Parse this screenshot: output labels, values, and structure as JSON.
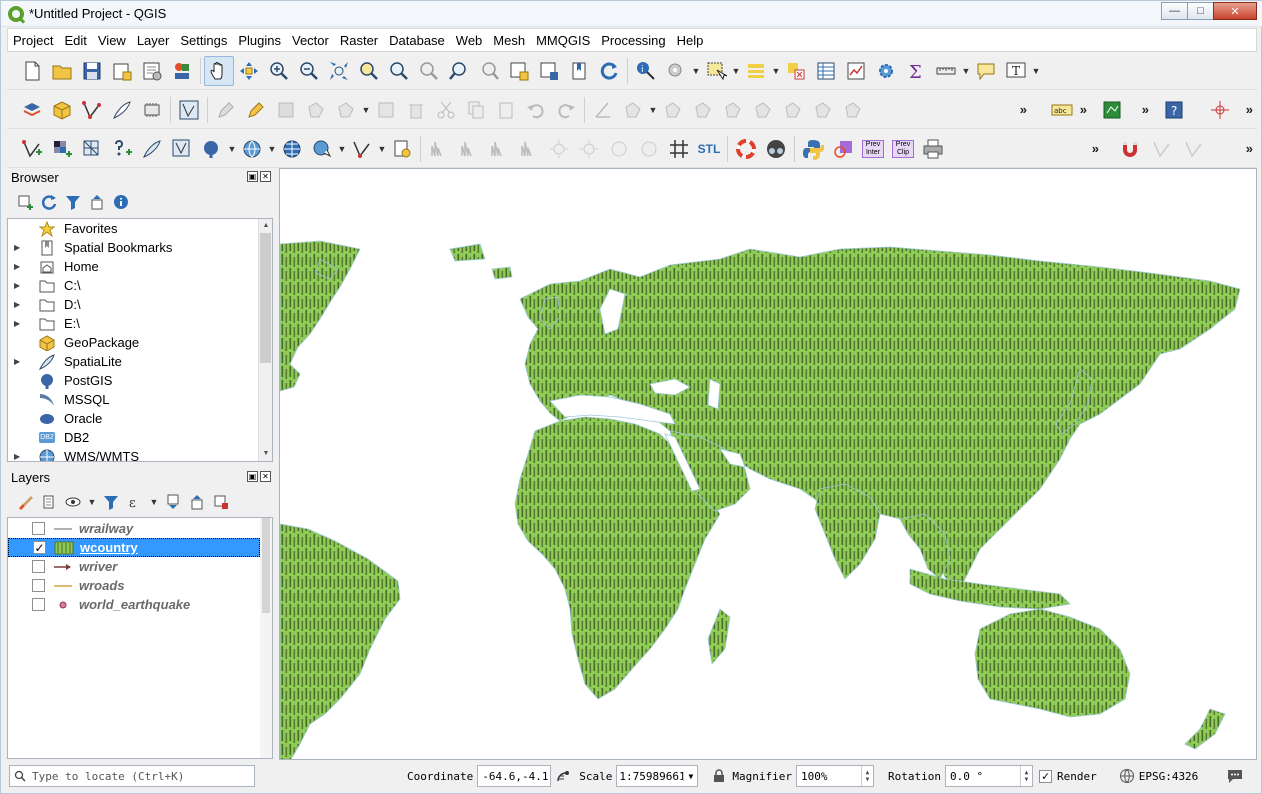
{
  "window": {
    "title": "*Untitled Project - QGIS"
  },
  "menu": [
    "Project",
    "Edit",
    "View",
    "Layer",
    "Settings",
    "Plugins",
    "Vector",
    "Raster",
    "Database",
    "Web",
    "Mesh",
    "MMQGIS",
    "Processing",
    "Help"
  ],
  "browser": {
    "title": "Browser",
    "items": [
      {
        "label": "Favorites",
        "icon": "star-icon",
        "expandable": false
      },
      {
        "label": "Spatial Bookmarks",
        "icon": "bookmark-icon",
        "expandable": true
      },
      {
        "label": "Home",
        "icon": "home-icon",
        "expandable": true
      },
      {
        "label": "C:\\",
        "icon": "folder-icon",
        "expandable": true
      },
      {
        "label": "D:\\",
        "icon": "folder-icon",
        "expandable": true
      },
      {
        "label": "E:\\",
        "icon": "folder-icon",
        "expandable": true
      },
      {
        "label": "GeoPackage",
        "icon": "geopackage-icon",
        "expandable": false
      },
      {
        "label": "SpatiaLite",
        "icon": "spatialite-icon",
        "expandable": true
      },
      {
        "label": "PostGIS",
        "icon": "postgis-icon",
        "expandable": false
      },
      {
        "label": "MSSQL",
        "icon": "mssql-icon",
        "expandable": false
      },
      {
        "label": "Oracle",
        "icon": "oracle-icon",
        "expandable": false
      },
      {
        "label": "DB2",
        "icon": "db2-icon",
        "expandable": false
      },
      {
        "label": "WMS/WMTS",
        "icon": "wms-icon",
        "expandable": true
      }
    ],
    "db2_badge": "DB2"
  },
  "layers": {
    "title": "Layers",
    "items": [
      {
        "name": "wrailway",
        "checked": false,
        "selected": false,
        "symbol": "line-gray"
      },
      {
        "name": "wcountry",
        "checked": true,
        "selected": true,
        "symbol": "fill-green"
      },
      {
        "name": "wriver",
        "checked": false,
        "selected": false,
        "symbol": "line-arrow"
      },
      {
        "name": "wroads",
        "checked": false,
        "selected": false,
        "symbol": "line-orange"
      },
      {
        "name": "world_earthquake",
        "checked": false,
        "selected": false,
        "symbol": "point-pink"
      }
    ]
  },
  "toolbar_labels": {
    "stl": "STL",
    "prev_inter": "Prev Inter",
    "prev_clip": "Prev Clip",
    "label_abc": "abc"
  },
  "status": {
    "locate_placeholder": "Type to locate (Ctrl+K)",
    "coordinate_label": "Coordinate",
    "coordinate_value": "-64.6,-4.1",
    "scale_label": "Scale",
    "scale_value": "1:75989661",
    "magnifier_label": "Magnifier",
    "magnifier_value": "100%",
    "rotation_label": "Rotation",
    "rotation_value": "0.0 °",
    "render_label": "Render",
    "render_checked": true,
    "crs": "EPSG:4326"
  },
  "colors": {
    "land": "#8fcc55",
    "hatch": "#4a6a2a",
    "selection": "#3399ff",
    "water": "#ffffff"
  }
}
